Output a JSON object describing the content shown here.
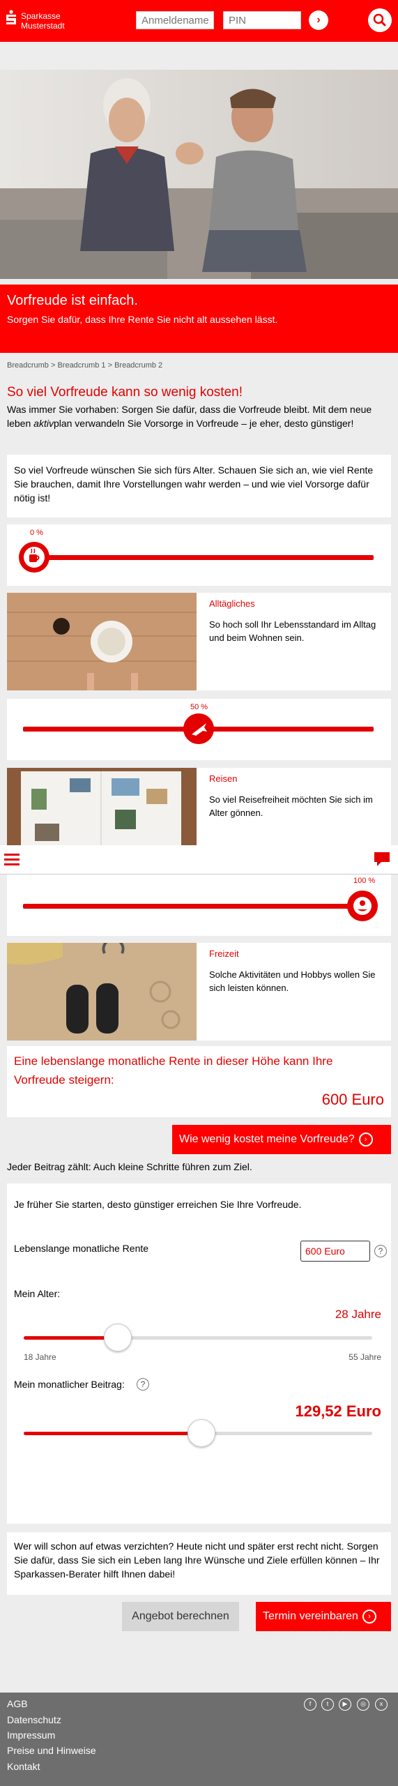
{
  "header": {
    "bank_name_line1": "Sparkasse",
    "bank_name_line2": "Musterstadt",
    "username_placeholder": "Anmeldename",
    "pin_placeholder": "PIN",
    "login_arrow": "›"
  },
  "banner": {
    "title": "Vorfreude ist einfach.",
    "subtitle": "Sorgen Sie dafür, dass Ihre Rente Sie nicht alt aussehen lässt."
  },
  "breadcrumb": "Breadcrumb > Breadcrumb 1 > Breadcrumb 2",
  "page_title": "So viel Vorfreude kann so wenig kosten!",
  "intro": {
    "part1": "Was immer Sie vorhaben: Sorgen Sie dafür, dass die Vorfreude bleibt. Mit dem neue leben ",
    "italic": "aktiv",
    "part2": "plan verwandeln Sie Vorsorge in Vorfreude – je eher, desto günstiger!"
  },
  "question_card": "So viel Vorfreude wünschen Sie sich fürs Alter. Schauen Sie sich an, wie viel Rente Sie brauchen, damit Ihre Vorstellungen wahr werden – und wie viel Vorsorge dafür nötig ist!",
  "sliders": [
    {
      "label": "0 %",
      "value": 0
    },
    {
      "label": "50 %",
      "value": 50
    },
    {
      "label": "100 %",
      "value": 100
    }
  ],
  "categories": [
    {
      "title": "Alltägliches",
      "text": "So hoch soll Ihr Lebensstandard im Alltag und beim Wohnen sein."
    },
    {
      "title": "Reisen",
      "text": "So viel Reisefreiheit möchten Sie sich im Alter gönnen."
    },
    {
      "title": "Freizeit",
      "text": "Solche Aktivitäten und Hobbys wollen Sie sich leisten können."
    }
  ],
  "result": {
    "heading": "Eine lebenslange monatliche Rente in dieser Höhe kann Ihre Vorfreude steigern:",
    "value": "600 Euro"
  },
  "cta_cost": "Wie wenig kostet meine Vorfreude?",
  "hint": "Jeder Beitrag zählt: Auch kleine Schritte führen zum Ziel.",
  "calculator": {
    "intro": "Je früher Sie starten, desto günstiger erreichen Sie Ihre Vorfreude.",
    "rente_label": "Lebenslange monatliche Rente",
    "rente_value": "600 Euro",
    "help": "?",
    "age_label": "Mein Alter:",
    "age_value": "28 Jahre",
    "age_min": "18 Jahre",
    "age_max": "55 Jahre",
    "age_fraction": 0.27,
    "beitrag_label": "Mein monatlicher Beitrag:",
    "beitrag_value": "129,52 Euro",
    "beitrag_fraction": 0.51
  },
  "bottom_text": "Wer will schon auf etwas verzichten? Heute nicht und später erst recht nicht. Sorgen Sie dafür, dass Sie sich ein Leben lang Ihre Wünsche und Ziele erfüllen können – Ihr Sparkassen-Berater hilft Ihnen dabei!",
  "buttons": {
    "calc": "Angebot berechnen",
    "appointment": "Termin vereinbaren",
    "arrow": "›"
  },
  "footer": {
    "links": [
      "AGB",
      "Datenschutz",
      "Impressum",
      "Preise und Hinweise",
      "Kontakt"
    ],
    "social": [
      {
        "icon": "facebook-icon",
        "glyph": "f"
      },
      {
        "icon": "twitter-icon",
        "glyph": "t"
      },
      {
        "icon": "youtube-icon",
        "glyph": "▶"
      },
      {
        "icon": "instagram-icon",
        "glyph": "◎"
      },
      {
        "icon": "xing-icon",
        "glyph": "x"
      }
    ]
  },
  "colors": {
    "brand": "#ff0000",
    "footer": "#6e6e6e"
  }
}
